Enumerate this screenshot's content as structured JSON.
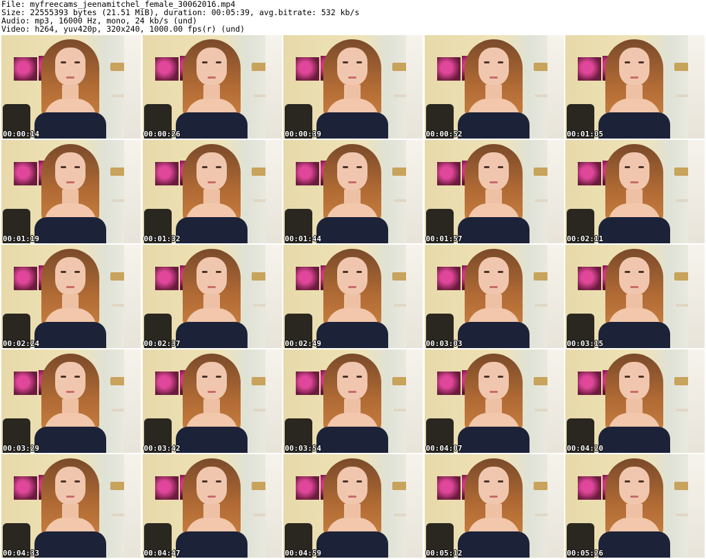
{
  "header": {
    "file": "File: myfreecams_jeenamitchel_female_30062016.mp4",
    "size": "Size: 22555393 bytes (21.51 MiB), duration: 00:05:39, avg.bitrate: 532 kb/s",
    "audio": "Audio: mp3, 16000 Hz, mono, 24 kb/s (und)",
    "video": "Video: h264, yuv420p, 320x240, 1000.00 fps(r) (und)"
  },
  "thumbnails": [
    {
      "timestamp": "00:00:14"
    },
    {
      "timestamp": "00:00:26"
    },
    {
      "timestamp": "00:00:39"
    },
    {
      "timestamp": "00:00:52"
    },
    {
      "timestamp": "00:01:05"
    },
    {
      "timestamp": "00:01:19"
    },
    {
      "timestamp": "00:01:32"
    },
    {
      "timestamp": "00:01:44"
    },
    {
      "timestamp": "00:01:57"
    },
    {
      "timestamp": "00:02:11"
    },
    {
      "timestamp": "00:02:24"
    },
    {
      "timestamp": "00:02:37"
    },
    {
      "timestamp": "00:02:49"
    },
    {
      "timestamp": "00:03:03"
    },
    {
      "timestamp": "00:03:15"
    },
    {
      "timestamp": "00:03:29"
    },
    {
      "timestamp": "00:03:42"
    },
    {
      "timestamp": "00:03:54"
    },
    {
      "timestamp": "00:04:07"
    },
    {
      "timestamp": "00:04:20"
    },
    {
      "timestamp": "00:04:33"
    },
    {
      "timestamp": "00:04:47"
    },
    {
      "timestamp": "00:04:59"
    },
    {
      "timestamp": "00:05:12"
    },
    {
      "timestamp": "00:05:26"
    }
  ]
}
